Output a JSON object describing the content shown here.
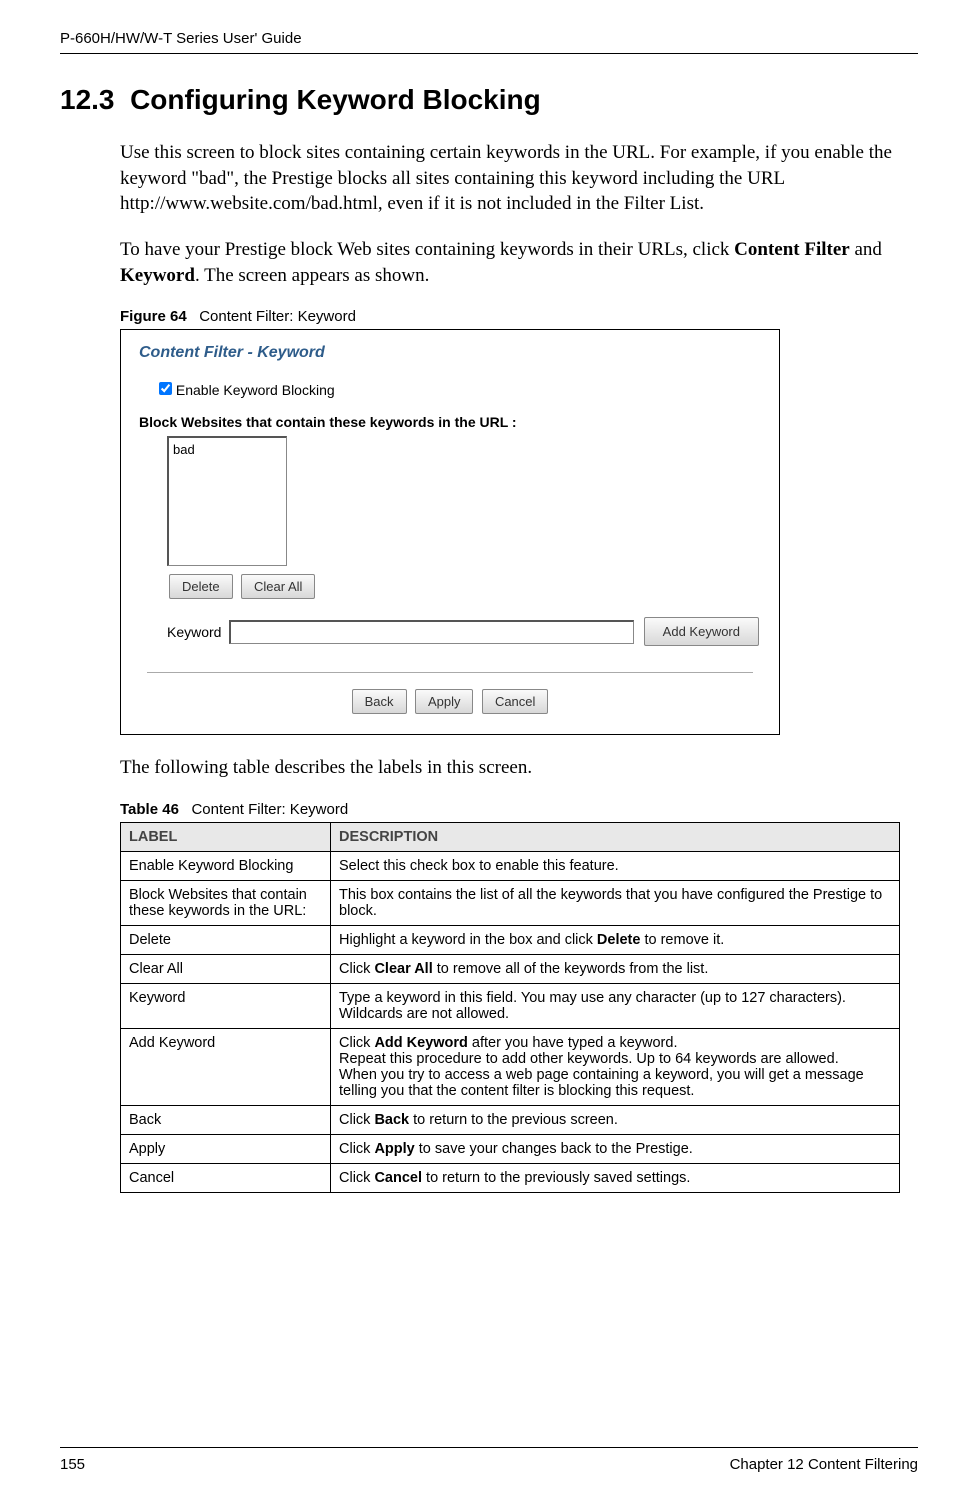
{
  "header": {
    "left": "P-660H/HW/W-T Series User' Guide",
    "right": ""
  },
  "section": {
    "number": "12.3",
    "title": "Configuring Keyword Blocking"
  },
  "para1": "Use this screen to block sites containing certain keywords in the URL. For example, if you enable the keyword \"bad\", the Prestige blocks all sites containing this keyword including the URL http://www.website.com/bad.html, even if it is not included in the Filter List.",
  "para2_pre": "To have your Prestige block Web sites containing keywords in their URLs, click ",
  "para2_b1": "Content Filter",
  "para2_mid": " and ",
  "para2_b2": "Keyword",
  "para2_post": ". The screen appears as shown.",
  "figure": {
    "label": "Figure 64",
    "caption": "Content Filter: Keyword",
    "panel_title": "Content Filter - Keyword",
    "checkbox_label": "Enable Keyword Blocking",
    "sub_label": "Block Websites that contain these keywords in the URL :",
    "list_item": "bad",
    "delete": "Delete",
    "clearall": "Clear All",
    "keyword_label": "Keyword",
    "addkw": "Add Keyword",
    "back": "Back",
    "apply": "Apply",
    "cancel": "Cancel"
  },
  "table_intro": "The following table describes the labels in this screen.",
  "table": {
    "label": "Table 46",
    "caption": "Content Filter: Keyword",
    "head_label": "LABEL",
    "head_desc": "DESCRIPTION",
    "rows": {
      "r0l": "Enable Keyword Blocking",
      "r0d": "Select this check box to enable this feature.",
      "r1l": "Block Websites that contain these keywords in the URL:",
      "r1d": "This box contains the list of all the keywords that you have configured the Prestige to block.",
      "r2l": "Delete",
      "r2d_pre": "Highlight a keyword in the box and click ",
      "r2d_b": "Delete",
      "r2d_post": " to remove it.",
      "r3l": "Clear All",
      "r3d_pre": "Click ",
      "r3d_b": "Clear All",
      "r3d_post": " to remove all of the keywords from the list.",
      "r4l": "Keyword",
      "r4d": "Type a keyword in this field. You may use any character (up to 127 characters). Wildcards are not allowed.",
      "r5l": "Add Keyword",
      "r5d_1pre": "Click ",
      "r5d_1b": "Add Keyword",
      "r5d_1post": " after you have typed a keyword.",
      "r5d_2": "Repeat this procedure to add other keywords. Up to 64 keywords are allowed.",
      "r5d_3": "When you try to access a web page containing a keyword, you will get a message telling you that the content filter is blocking this request.",
      "r6l": "Back",
      "r6d_pre": "Click ",
      "r6d_b": "Back",
      "r6d_post": " to return to the previous screen.",
      "r7l": "Apply",
      "r7d_pre": "Click ",
      "r7d_b": "Apply",
      "r7d_post": " to save your changes back to the Prestige.",
      "r8l": "Cancel",
      "r8d_pre": "Click ",
      "r8d_b": "Cancel",
      "r8d_post": " to return to the previously saved settings."
    }
  },
  "footer": {
    "page": "155",
    "chapter": "Chapter 12 Content Filtering"
  }
}
